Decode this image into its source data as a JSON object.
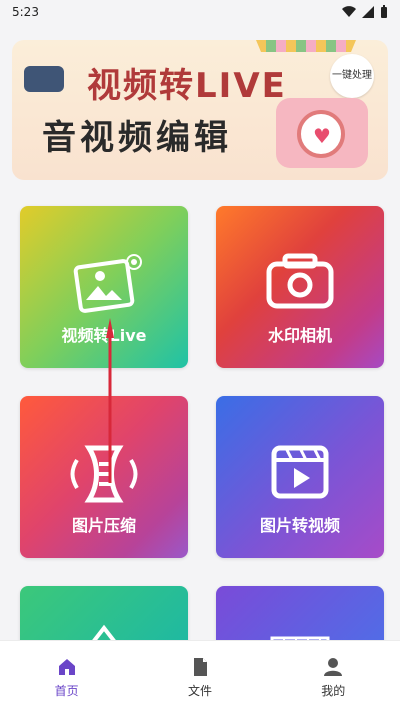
{
  "status_bar": {
    "time": "5:23"
  },
  "banner": {
    "title_line1": "视频转LIVE",
    "title_line2": "音视频编辑",
    "badge": "一键处理"
  },
  "tiles": [
    {
      "label": "视频转Live",
      "icon": "photo-gallery-icon"
    },
    {
      "label": "水印相机",
      "icon": "camera-icon"
    },
    {
      "label": "图片压缩",
      "icon": "compress-icon"
    },
    {
      "label": "图片转视频",
      "icon": "video-clapper-icon"
    },
    {
      "label": "",
      "icon": "shape-icon"
    },
    {
      "label": "",
      "icon": "grid-icon"
    }
  ],
  "bottom_nav": {
    "items": [
      {
        "label": "首页",
        "icon": "home-icon",
        "active": true
      },
      {
        "label": "文件",
        "icon": "file-icon",
        "active": false
      },
      {
        "label": "我的",
        "icon": "profile-icon",
        "active": false
      }
    ]
  },
  "colors": {
    "accent": "#6a45c8",
    "arrow_annotation": "#d8283a"
  }
}
